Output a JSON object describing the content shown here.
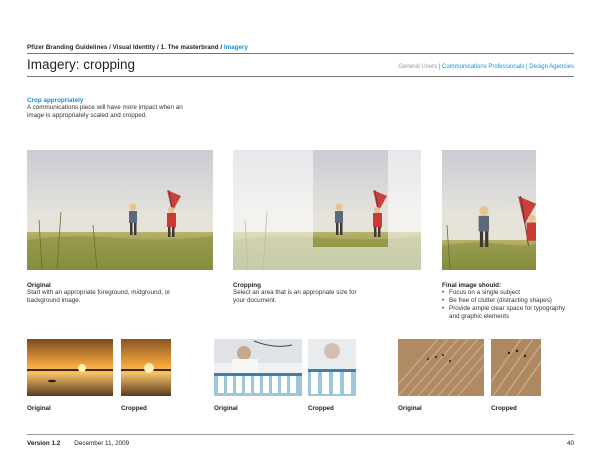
{
  "header": {
    "breadcrumb_path": "Pfizer Branding Guidelines / Visual Identity / 1. The masterbrand / ",
    "breadcrumb_current": "Imagery",
    "title": "Imagery: cropping",
    "audience": {
      "general": "General Users",
      "sep1": " | ",
      "comms": "Communications Professionals",
      "sep2": " | ",
      "design": "Design Agencies"
    }
  },
  "intro": {
    "heading": "Crop appropriately",
    "body": "A communications piece will have more impact when an image is appropriately scaled and cropped."
  },
  "examples": {
    "original": {
      "title": "Original",
      "body": "Start with an appropriate foreground, midground, or background image."
    },
    "cropping": {
      "title": "Cropping",
      "body": "Select an area that is an appropriate size for your document."
    },
    "final": {
      "title": "Final image should:",
      "rules": [
        "Focus on a single subject",
        "Be free of clutter (distracting shapes)",
        "Provide ample clear space for typography and graphic elements"
      ]
    }
  },
  "pairs": [
    {
      "original_label": "Original",
      "cropped_label": "Cropped"
    },
    {
      "original_label": "Original",
      "cropped_label": "Cropped"
    },
    {
      "original_label": "Original",
      "cropped_label": "Cropped"
    }
  ],
  "footer": {
    "version": "Version 1.2",
    "date": "December 11, 2009",
    "page": "40"
  },
  "colors": {
    "accent": "#1a8fd0",
    "text": "#222222"
  }
}
